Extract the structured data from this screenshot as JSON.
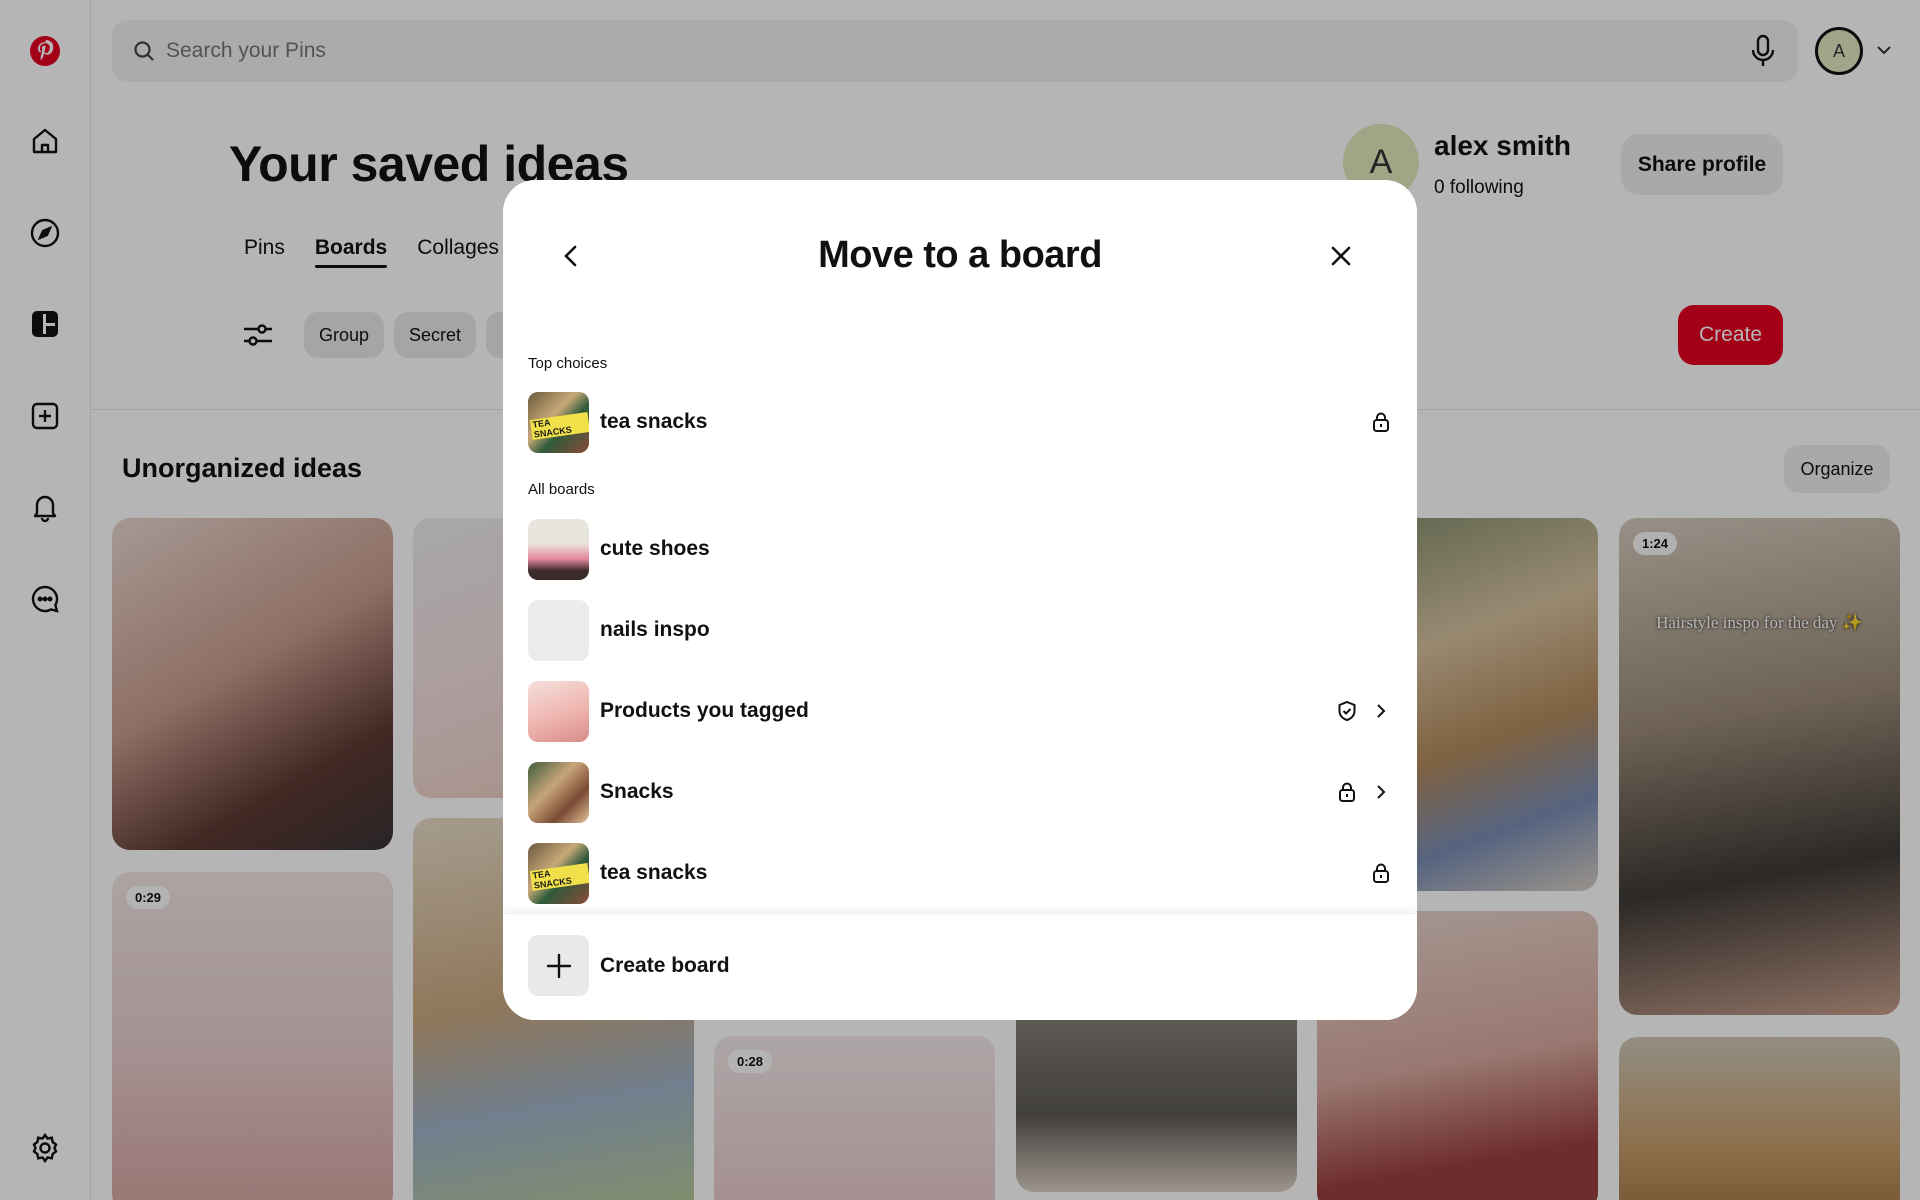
{
  "search": {
    "placeholder": "Search your Pins"
  },
  "user": {
    "initial": "A",
    "name": "alex smith",
    "following": "0 following"
  },
  "header": {
    "title": "Your saved ideas",
    "share_label": "Share profile",
    "create_label": "Create"
  },
  "tabs": [
    {
      "label": "Pins",
      "active": false
    },
    {
      "label": "Boards",
      "active": true
    },
    {
      "label": "Collages",
      "active": false
    }
  ],
  "filters": [
    "Group",
    "Secret"
  ],
  "section": {
    "title": "Unorganized ideas",
    "organize_label": "Organize"
  },
  "pins": [
    {
      "duration": ""
    },
    {
      "duration": "0:29"
    },
    {
      "duration": ""
    },
    {
      "duration": ""
    },
    {
      "duration": "0:28"
    },
    {
      "duration": ""
    },
    {
      "duration": ""
    },
    {
      "duration": ""
    },
    {
      "duration": "1:24",
      "caption": "Hairstyle inspo for the day ✨"
    },
    {
      "duration": ""
    }
  ],
  "modal": {
    "title": "Move to a board",
    "top_choices_label": "Top choices",
    "all_boards_label": "All boards",
    "top_choices": [
      {
        "name": "tea snacks",
        "icons": [
          "lock-icon"
        ]
      }
    ],
    "boards": [
      {
        "name": "cute shoes",
        "icons": []
      },
      {
        "name": "nails inspo",
        "icons": []
      },
      {
        "name": "Products you tagged",
        "icons": [
          "shield-check-icon",
          "chevron-right-icon"
        ]
      },
      {
        "name": "Snacks",
        "icons": [
          "lock-icon",
          "chevron-right-icon"
        ]
      },
      {
        "name": "tea snacks",
        "icons": [
          "lock-icon"
        ]
      }
    ],
    "create_board_label": "Create board",
    "thumb_text": "TEA SNACKS"
  },
  "colors": {
    "brand_red": "#e60023",
    "avatar_bg": "#dfeabd"
  }
}
